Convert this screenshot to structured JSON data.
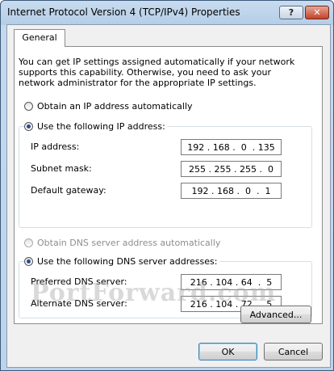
{
  "window": {
    "title": "Internet Protocol Version 4 (TCP/IPv4) Properties",
    "help_label": "?",
    "close_label": "✕"
  },
  "tabs": [
    {
      "label": "General",
      "selected": true
    }
  ],
  "intro_text": "You can get IP settings assigned automatically if your network supports this capability. Otherwise, you need to ask your network administrator for the appropriate IP settings.",
  "ip_section": {
    "auto_label": "Obtain an IP address automatically",
    "manual_label": "Use the following IP address:",
    "selected": "manual",
    "fields": [
      {
        "label": "IP address:",
        "value": "192 . 168 .  0  . 135"
      },
      {
        "label": "Subnet mask:",
        "value": "255 . 255 . 255 .  0"
      },
      {
        "label": "Default gateway:",
        "value": "192 . 168 .  0  .  1"
      }
    ]
  },
  "dns_section": {
    "auto_label": "Obtain DNS server address automatically",
    "manual_label": "Use the following DNS server addresses:",
    "selected": "manual",
    "auto_enabled": false,
    "fields": [
      {
        "label": "Preferred DNS server:",
        "value": "216 . 104 . 64  .  5"
      },
      {
        "label": "Alternate DNS server:",
        "value": "216 . 104 . 72  .  5"
      }
    ]
  },
  "watermark": "PortForward.com",
  "buttons": {
    "advanced": "Advanced...",
    "ok": "OK",
    "cancel": "Cancel"
  }
}
